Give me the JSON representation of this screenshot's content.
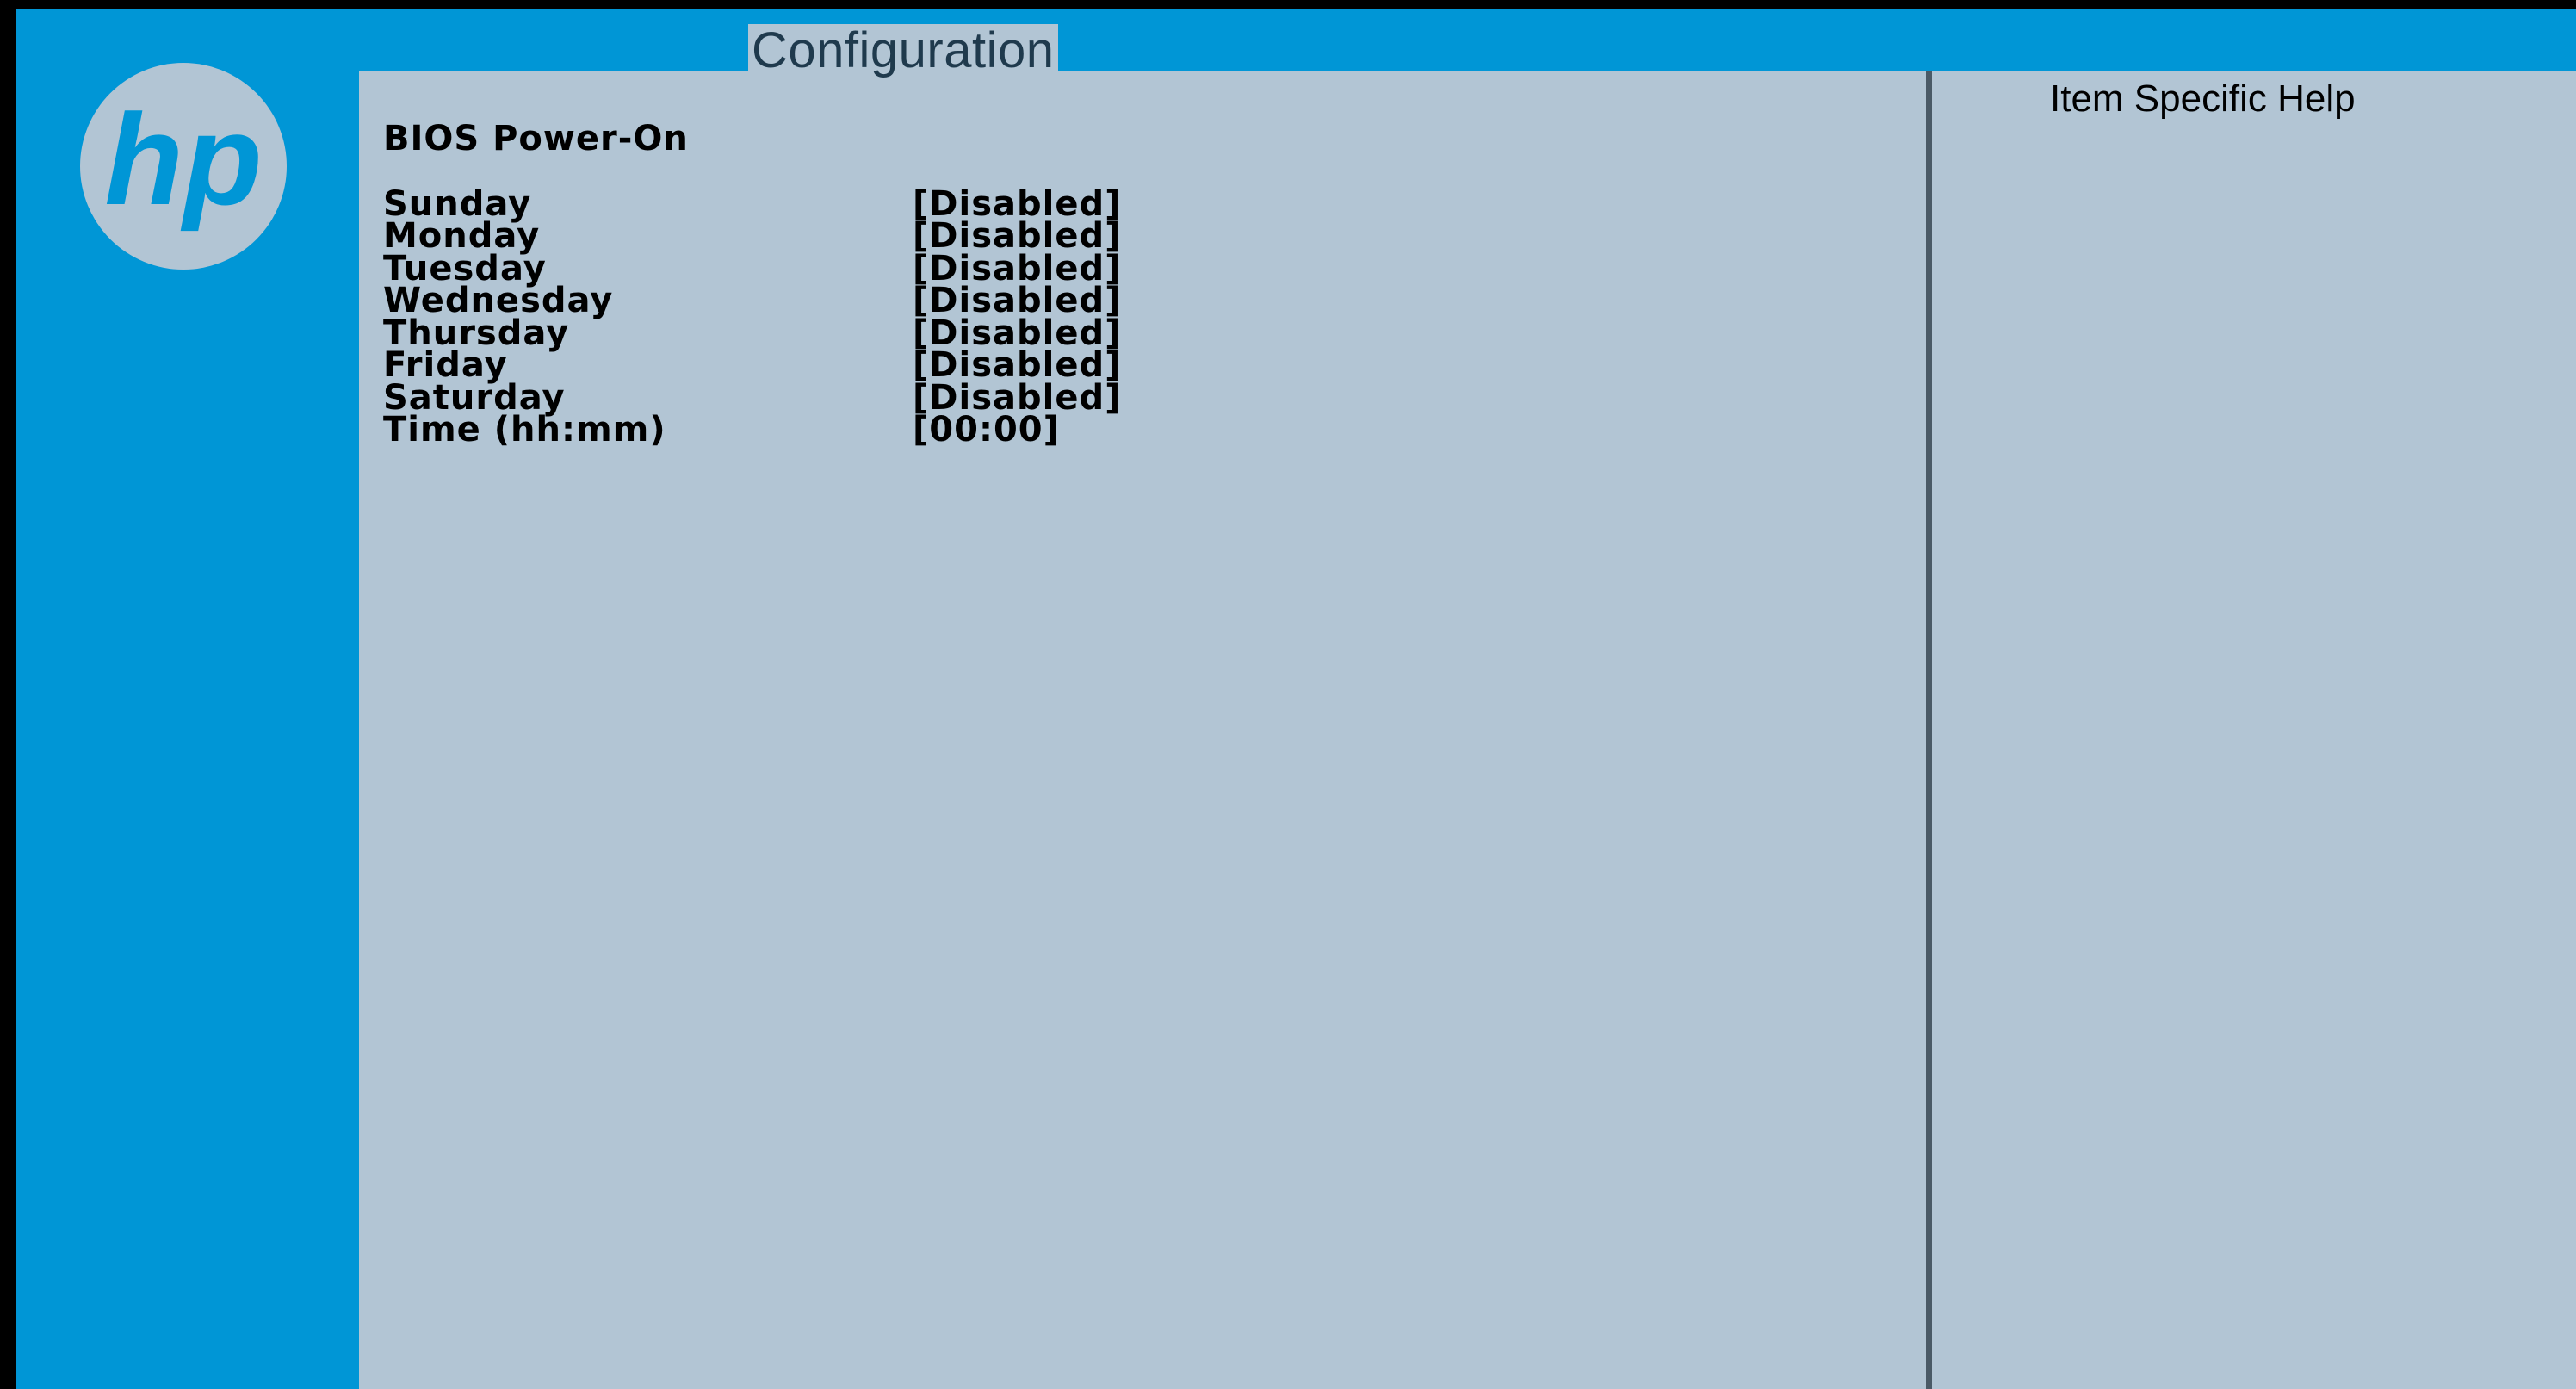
{
  "colors": {
    "frame_blue": "#0096d6",
    "panel_gray": "#b2c5d4",
    "divider": "#4a5a66",
    "outer_border": "#000000"
  },
  "logo": {
    "icon": "hp-logo",
    "text": "hp"
  },
  "header": {
    "active_tab": "Configuration"
  },
  "main": {
    "section_title": "BIOS Power-On",
    "settings": [
      {
        "label": "Sunday",
        "value": "[Disabled]"
      },
      {
        "label": "Monday",
        "value": "[Disabled]"
      },
      {
        "label": "Tuesday",
        "value": "[Disabled]"
      },
      {
        "label": "Wednesday",
        "value": "[Disabled]"
      },
      {
        "label": "Thursday",
        "value": "[Disabled]"
      },
      {
        "label": "Friday",
        "value": "[Disabled]"
      },
      {
        "label": "Saturday",
        "value": "[Disabled]"
      },
      {
        "label": "Time (hh:mm)",
        "value": "[00:00]"
      }
    ]
  },
  "help": {
    "title": "Item Specific Help"
  }
}
